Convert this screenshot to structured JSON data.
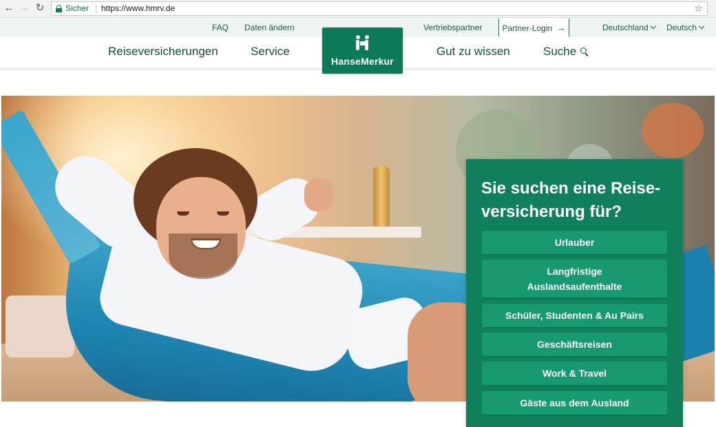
{
  "browser": {
    "secure_label": "Sicher",
    "url": "https://www.hmrv.de"
  },
  "utility_nav": {
    "faq": "FAQ",
    "update_data": "Daten ändern",
    "sales_partner": "Vertriebspartner",
    "partner_login": "Partner-Login",
    "country": "Deutschland",
    "language": "Deutsch"
  },
  "main_nav": {
    "travel_insurance": "Reiseversicherungen",
    "service": "Service",
    "good_to_know": "Gut zu wissen",
    "search": "Suche"
  },
  "logo": {
    "text": "HanseMerkur"
  },
  "teaser": {
    "title": "Sie suchen eine Reise-versicherung für?",
    "title_line1": "Sie suchen eine Reise-",
    "title_line2": "versicherung für?",
    "options": [
      "Urlauber",
      "Langfristige Auslandsaufenthalte",
      "Schüler, Studenten & Au Pairs",
      "Geschäftsreisen",
      "Work & Travel",
      "Gäste aus dem Ausland"
    ],
    "option_2_line1": "Langfristige",
    "option_2_line2": "Auslandsaufenthalte"
  },
  "colors": {
    "brand_green": "#0c7a59",
    "card_bg": "#0f7f5d",
    "button_bg": "#179a6f",
    "nav_text": "#144c3b"
  },
  "icons": {
    "back": "arrow-left-icon",
    "forward": "arrow-right-icon",
    "reload": "reload-icon",
    "lock": "lock-icon",
    "bookmark": "star-icon",
    "login_arrow": "arrow-right-icon",
    "dropdown": "chevron-down-icon",
    "search": "search-icon"
  }
}
